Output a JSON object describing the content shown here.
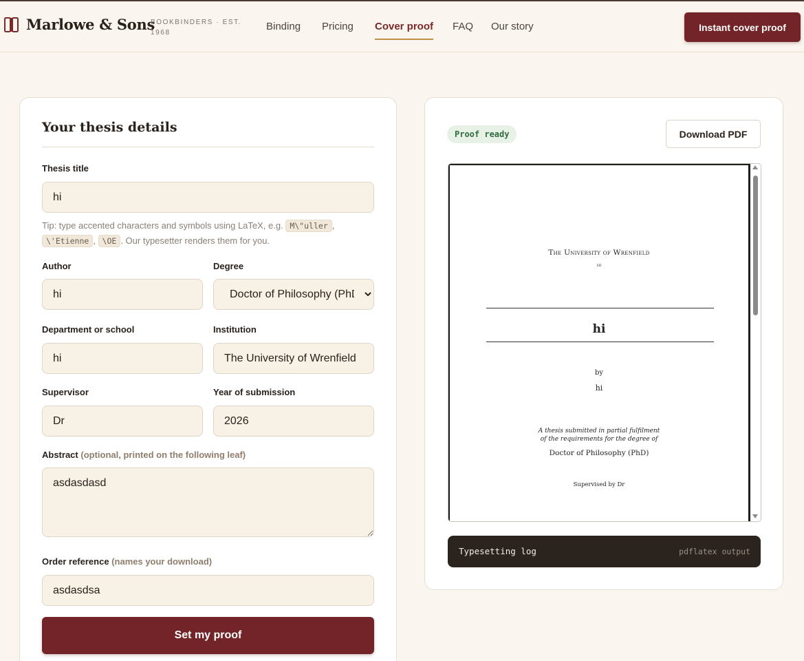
{
  "header": {
    "brand_name": "Marlowe & Sons",
    "brand_sub": "BOOKBINDERS · EST. 1968",
    "nav": [
      {
        "label": "Binding",
        "active": false
      },
      {
        "label": "Pricing",
        "active": false
      },
      {
        "label": "Cover proof",
        "active": true
      },
      {
        "label": "FAQ",
        "active": false
      },
      {
        "label": "Our story",
        "active": false
      }
    ],
    "cta_label": "Instant cover proof"
  },
  "form": {
    "title": "Your thesis details",
    "thesis_title": {
      "label": "Thesis title",
      "value": "hi"
    },
    "tip": {
      "before": "Tip: type accented characters and symbols using LaTeX, e.g. ",
      "code1": "M\\\"uller",
      "sep1": ", ",
      "code2": "\\'Etienne",
      "sep2": ", ",
      "code3": "\\OE",
      "after": ". Our typesetter renders them for you."
    },
    "author": {
      "label": "Author",
      "value": "hi"
    },
    "degree": {
      "label": "Degree",
      "value": "Doctor of Philosophy (PhD)"
    },
    "department": {
      "label": "Department or school",
      "value": "hi"
    },
    "institution": {
      "label": "Institution",
      "value": "The University of Wrenfield"
    },
    "supervisor": {
      "label": "Supervisor",
      "value": "Dr"
    },
    "year": {
      "label": "Year of submission",
      "value": "2026"
    },
    "abstract": {
      "label": "Abstract",
      "hint": "(optional, printed on the following leaf)",
      "value": "asdasdasd"
    },
    "order_ref": {
      "label": "Order reference",
      "hint": "(names your download)",
      "value": "asdasdsa"
    },
    "submit_label": "Set my proof"
  },
  "preview": {
    "status": "Proof ready",
    "download_label": "Download PDF",
    "page": {
      "university": "The University of Wrenfield",
      "department": "hi",
      "title": "hi",
      "by": "by",
      "author": "hi",
      "submitted_line1": "A thesis submitted in partial fulfilment",
      "submitted_line2": "of the requirements for the degree of",
      "degree": "Doctor of Philosophy (PhD)",
      "supervised": "Supervised by Dr"
    },
    "log_title": "Typesetting log",
    "log_meta": "pdflatex output"
  },
  "colors": {
    "accent": "#732428",
    "background": "#faf5ee",
    "nav_underline": "#c18f47",
    "badge_text": "#2f6b3e"
  }
}
